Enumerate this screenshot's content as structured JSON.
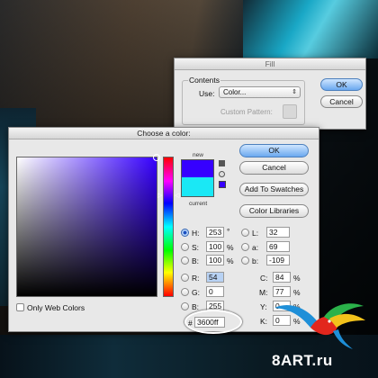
{
  "fill_dialog": {
    "title": "Fill",
    "contents_group": "Contents",
    "use_label": "Use:",
    "use_value": "Color...",
    "custom_pattern_label": "Custom Pattern:",
    "ok_label": "OK",
    "cancel_label": "Cancel"
  },
  "color_picker": {
    "title": "Choose a color:",
    "new_label": "new",
    "current_label": "current",
    "new_color": "#3600ff",
    "current_color": "#1ae8f5",
    "buttons": {
      "ok": "OK",
      "cancel": "Cancel",
      "add_to_swatches": "Add To Swatches",
      "color_libraries": "Color Libraries"
    },
    "hsb": {
      "h_label": "H:",
      "h_value": "253",
      "h_unit": "°",
      "s_label": "S:",
      "s_value": "100",
      "s_unit": "%",
      "b_label": "B:",
      "b_value": "100",
      "b_unit": "%"
    },
    "rgb": {
      "r_label": "R:",
      "r_value": "54",
      "g_label": "G:",
      "g_value": "0",
      "b_label": "B:",
      "b_value": "255"
    },
    "lab": {
      "l_label": "L:",
      "l_value": "32",
      "a_label": "a:",
      "a_value": "69",
      "b_label": "b:",
      "b_value": "-109"
    },
    "cmyk": {
      "c_label": "C:",
      "c_value": "84",
      "c_unit": "%",
      "m_label": "M:",
      "m_value": "77",
      "m_unit": "%",
      "y_label": "Y:",
      "y_value": "0",
      "y_unit": "%",
      "k_label": "K:",
      "k_value": "0",
      "k_unit": "%"
    },
    "only_web_colors_label": "Only Web Colors",
    "hex_prefix": "#",
    "hex_value": "3600ff"
  },
  "watermark": "8ART.ru"
}
